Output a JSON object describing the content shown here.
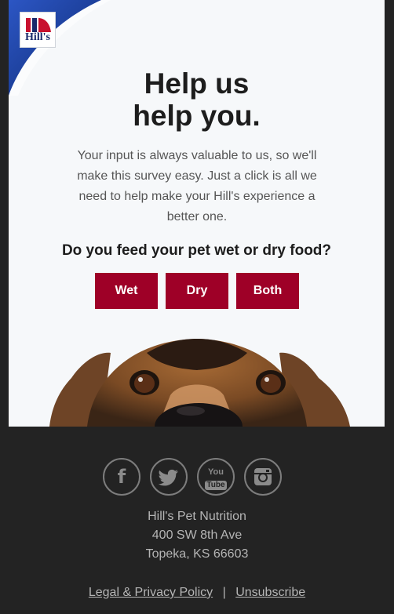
{
  "brand": {
    "logo_text": "Hill's",
    "colors": {
      "accent": "#9e0027",
      "corner_blue": "#1b3f9b",
      "footer_bg": "#232323"
    }
  },
  "hero": {
    "headline_line1": "Help us",
    "headline_line2": "help you.",
    "intro": "Your input is always valuable to us, so we'll make this survey easy. Just a click is all we need to help make your Hill's experience a better one."
  },
  "survey": {
    "question": "Do you feed your pet wet or dry food?",
    "options": [
      "Wet",
      "Dry",
      "Both"
    ]
  },
  "footer": {
    "social_icons": [
      "facebook-icon",
      "twitter-icon",
      "youtube-icon",
      "instagram-icon"
    ],
    "youtube_top": "You",
    "youtube_bottom": "Tube",
    "facebook_glyph": "f",
    "company": "Hill's Pet Nutrition",
    "street": "400 SW 8th Ave",
    "city": "Topeka, KS 66603",
    "legal_link": "Legal & Privacy Policy",
    "separator": "|",
    "unsubscribe_link": "Unsubscribe"
  }
}
